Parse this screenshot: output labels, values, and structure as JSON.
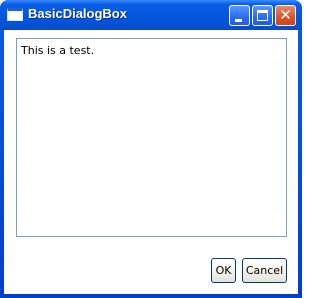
{
  "window": {
    "title": "BasicDialogBox",
    "controls": {
      "minimize_icon": "minimize-icon",
      "maximize_icon": "maximize-icon",
      "close_icon": "close-icon",
      "close_glyph": "✕"
    }
  },
  "content": {
    "textbox_value": "This is a test."
  },
  "buttons": {
    "ok_label": "OK",
    "cancel_label": "Cancel"
  },
  "colors": {
    "titlebar": "#0656e0",
    "close_button": "#d9542a",
    "textbox_border": "#7f9db9",
    "button_border": "#003c74"
  }
}
